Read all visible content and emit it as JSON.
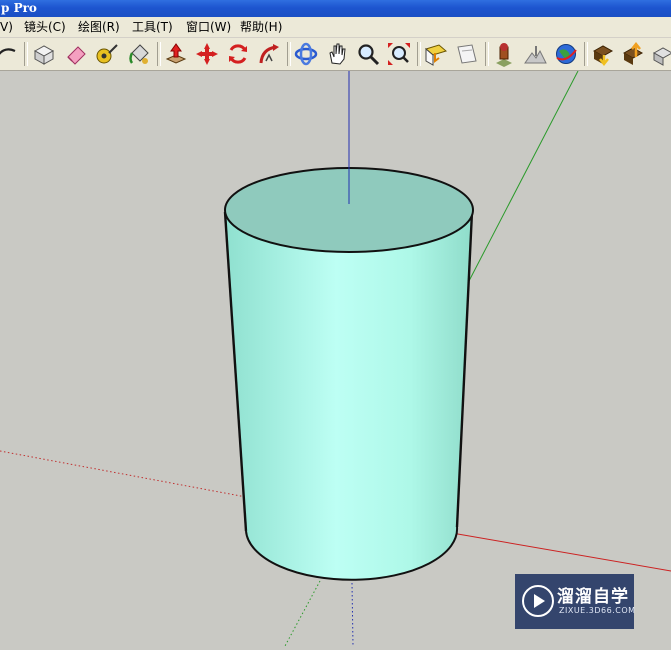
{
  "window": {
    "title": "p Pro"
  },
  "menu": {
    "items": [
      {
        "label": "V)"
      },
      {
        "label": "镜头(C)"
      },
      {
        "label": "绘图(R)"
      },
      {
        "label": "工具(T)"
      },
      {
        "label": "窗口(W)"
      },
      {
        "label": "帮助(H)"
      }
    ]
  },
  "toolbar": {
    "tools": [
      "arc-icon",
      "make-component-icon",
      "eraser-icon",
      "tape-measure-icon",
      "paint-bucket-icon",
      "push-pull-icon",
      "move-icon",
      "rotate-icon",
      "follow-me-icon",
      "orbit-icon",
      "pan-icon",
      "zoom-icon",
      "zoom-extents-icon",
      "section-plane-icon",
      "section-display-icon",
      "add-location-icon",
      "toggle-terrain-icon",
      "google-earth-icon",
      "get-models-icon",
      "share-model-icon",
      "share-component-icon"
    ]
  },
  "viewport": {
    "background_color": "#c9c9c4",
    "model": {
      "shape": "cylinder",
      "fill_top": "#8fcabd",
      "fill_side": "#b8fff0"
    },
    "axes": {
      "red": "#cc2222",
      "green": "#2a9a2a",
      "blue": "#2230b0"
    }
  },
  "watermark": {
    "title": "溜溜自学",
    "subtitle": "ZIXUE.3D66.COM"
  }
}
